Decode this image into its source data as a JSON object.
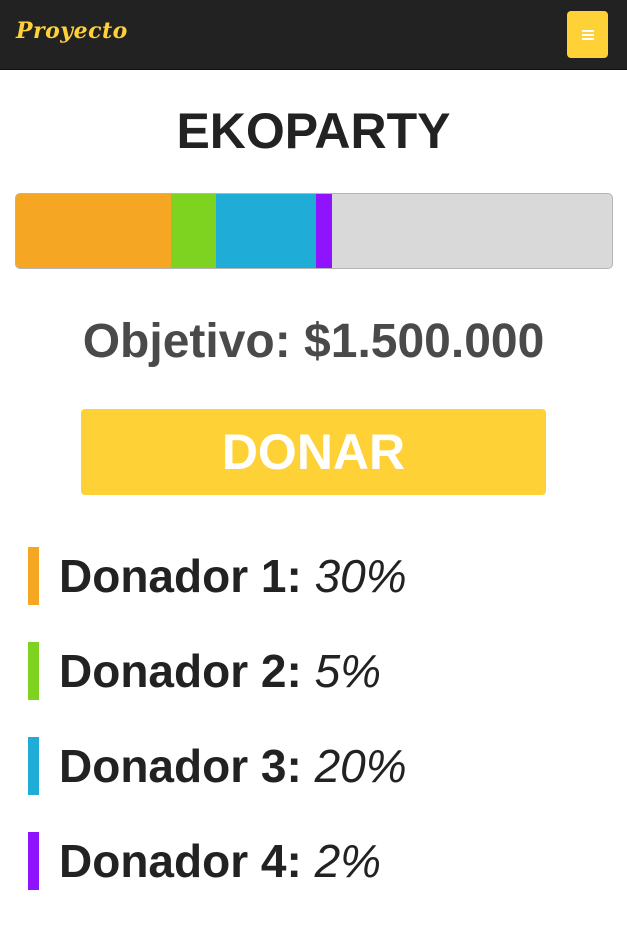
{
  "navbar": {
    "brand": "Proyecto",
    "menu_icon": "hamburger-menu-icon",
    "accent_color": "#fed136",
    "background_color": "#222222"
  },
  "project": {
    "title": "EKOPARTY",
    "goal_text": "Objetivo: $1.500.000",
    "donate_label": "DONAR"
  },
  "progress": {
    "track_color": "#d9d9d9",
    "segments": [
      {
        "donor": "Donador 1",
        "percent": 26,
        "color": "#f5a623"
      },
      {
        "donor": "Donador 2",
        "percent": 7.5,
        "color": "#7ed321"
      },
      {
        "donor": "Donador 3",
        "percent": 16.8,
        "color": "#1fadd7"
      },
      {
        "donor": "Donador 4",
        "percent": 2.7,
        "color": "#9013fe"
      }
    ]
  },
  "donors": [
    {
      "name": "Donador 1:",
      "share": "30%",
      "color": "#f5a623"
    },
    {
      "name": "Donador 2:",
      "share": "5%",
      "color": "#7ed321"
    },
    {
      "name": "Donador 3:",
      "share": "20%",
      "color": "#1fadd7"
    },
    {
      "name": "Donador 4:",
      "share": "2%",
      "color": "#9013fe"
    }
  ]
}
